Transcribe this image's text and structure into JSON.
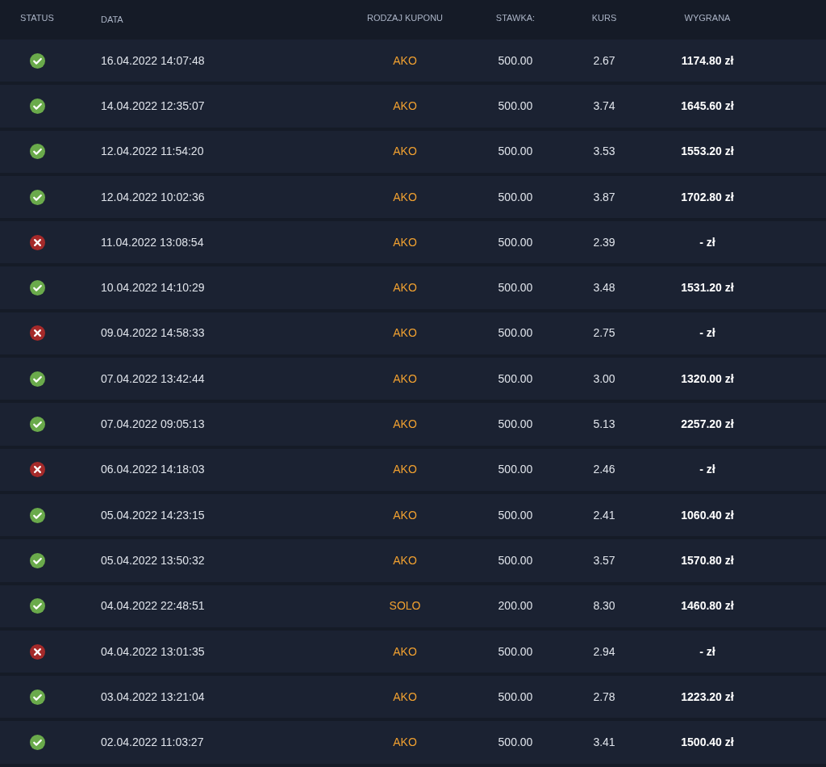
{
  "table": {
    "columns": [
      "STATUS",
      "DATA",
      "RODZAJ KUPONU",
      "STAWKA:",
      "KURS",
      "WYGRANA"
    ],
    "rows": [
      {
        "kind": "won",
        "date": "16.04.2022 14:07:48",
        "type": "AKO",
        "stake": "500.00",
        "odds": "2.67",
        "win": "1174.80 zł"
      },
      {
        "kind": "won",
        "date": "14.04.2022 12:35:07",
        "type": "AKO",
        "stake": "500.00",
        "odds": "3.74",
        "win": "1645.60 zł"
      },
      {
        "kind": "won",
        "date": "12.04.2022 11:54:20",
        "type": "AKO",
        "stake": "500.00",
        "odds": "3.53",
        "win": "1553.20 zł"
      },
      {
        "kind": "won",
        "date": "12.04.2022 10:02:36",
        "type": "AKO",
        "stake": "500.00",
        "odds": "3.87",
        "win": "1702.80 zł"
      },
      {
        "kind": "lost",
        "date": "11.04.2022 13:08:54",
        "type": "AKO",
        "stake": "500.00",
        "odds": "2.39",
        "win": "- zł"
      },
      {
        "kind": "won",
        "date": "10.04.2022 14:10:29",
        "type": "AKO",
        "stake": "500.00",
        "odds": "3.48",
        "win": "1531.20 zł"
      },
      {
        "kind": "lost",
        "date": "09.04.2022 14:58:33",
        "type": "AKO",
        "stake": "500.00",
        "odds": "2.75",
        "win": "- zł"
      },
      {
        "kind": "won",
        "date": "07.04.2022 13:42:44",
        "type": "AKO",
        "stake": "500.00",
        "odds": "3.00",
        "win": "1320.00 zł"
      },
      {
        "kind": "won",
        "date": "07.04.2022 09:05:13",
        "type": "AKO",
        "stake": "500.00",
        "odds": "5.13",
        "win": "2257.20 zł"
      },
      {
        "kind": "lost",
        "date": "06.04.2022 14:18:03",
        "type": "AKO",
        "stake": "500.00",
        "odds": "2.46",
        "win": "- zł"
      },
      {
        "kind": "won",
        "date": "05.04.2022 14:23:15",
        "type": "AKO",
        "stake": "500.00",
        "odds": "2.41",
        "win": "1060.40 zł"
      },
      {
        "kind": "won",
        "date": "05.04.2022 13:50:32",
        "type": "AKO",
        "stake": "500.00",
        "odds": "3.57",
        "win": "1570.80 zł"
      },
      {
        "kind": "won",
        "date": "04.04.2022 22:48:51",
        "type": "SOLO",
        "stake": "200.00",
        "odds": "8.30",
        "win": "1460.80 zł"
      },
      {
        "kind": "lost",
        "date": "04.04.2022 13:01:35",
        "type": "AKO",
        "stake": "500.00",
        "odds": "2.94",
        "win": "- zł"
      },
      {
        "kind": "won",
        "date": "03.04.2022 13:21:04",
        "type": "AKO",
        "stake": "500.00",
        "odds": "2.78",
        "win": "1223.20 zł"
      },
      {
        "kind": "won",
        "date": "02.04.2022 11:03:27",
        "type": "AKO",
        "stake": "500.00",
        "odds": "3.41",
        "win": "1500.40 zł"
      }
    ]
  }
}
